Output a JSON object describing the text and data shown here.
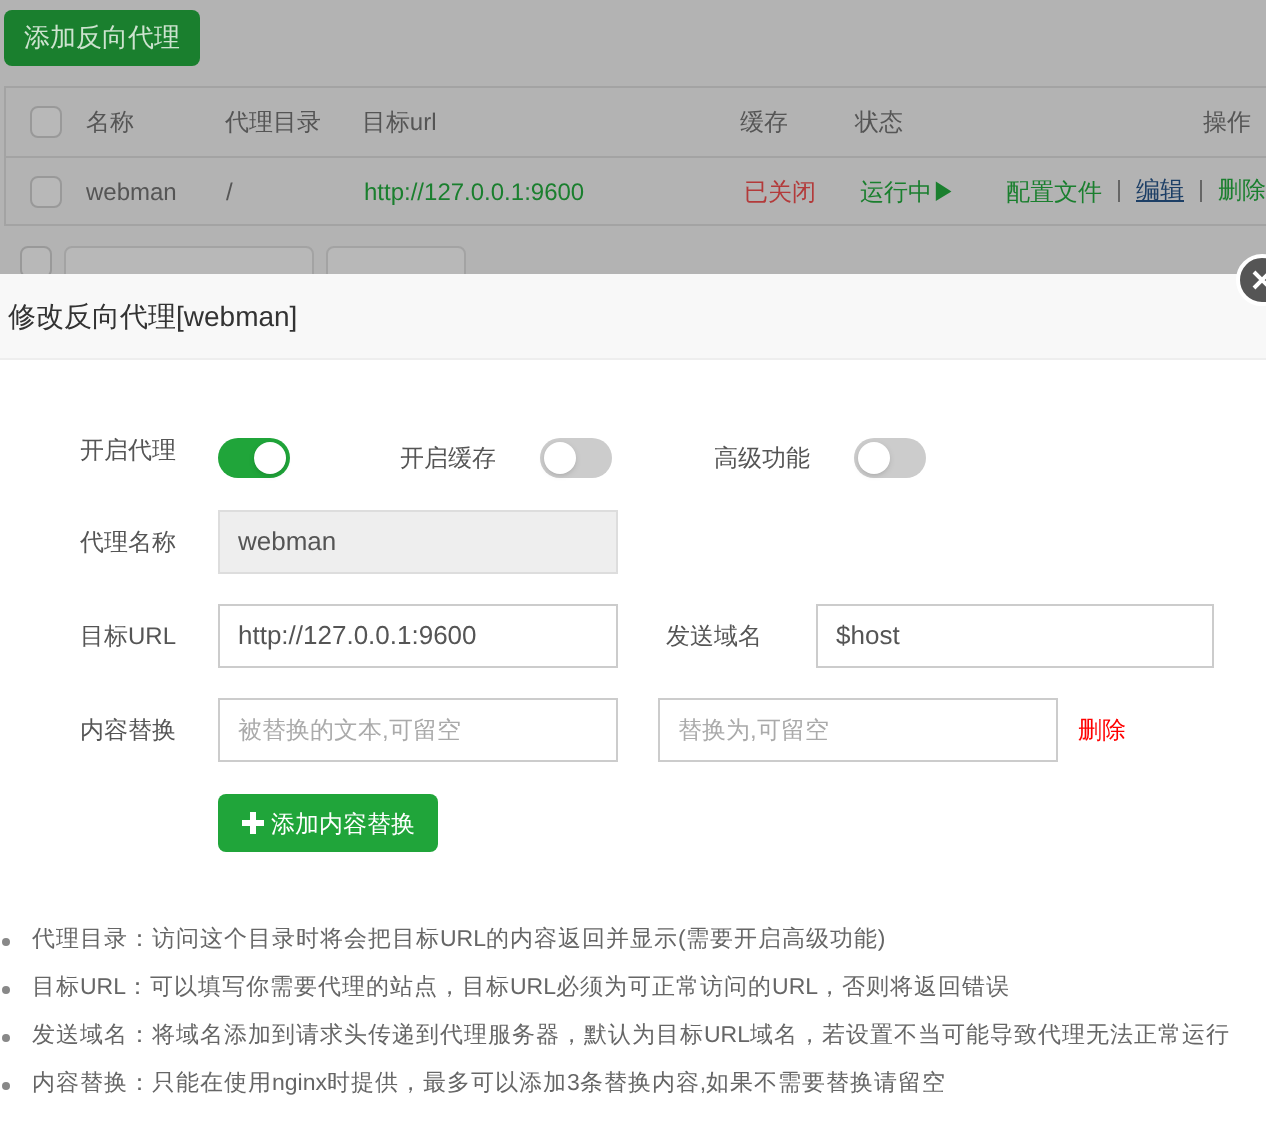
{
  "page": {
    "add_button": "添加反向代理",
    "table": {
      "all_selected": false,
      "columns": [
        "名称",
        "代理目录",
        "目标url",
        "缓存",
        "状态",
        "操作"
      ],
      "rows": [
        {
          "selected": false,
          "name": "webman",
          "dir": "/",
          "url": "http://127.0.0.1:9600",
          "cache": "已关闭",
          "status": "运行中▶",
          "actions": [
            {
              "label": "配置文件",
              "kind": "text"
            },
            {
              "label": "编辑",
              "kind": "link"
            },
            {
              "label": "删除",
              "kind": "text"
            }
          ]
        }
      ]
    },
    "batch_selected": false
  },
  "dialog": {
    "title": "修改反向代理[webman]",
    "toggles": [
      {
        "label": "开启代理",
        "on": true
      },
      {
        "label": "开启缓存",
        "on": false
      },
      {
        "label": "高级功能",
        "on": false
      }
    ],
    "name_label": "代理名称",
    "name_value": "webman",
    "url_label": "目标URL",
    "url_value": "http://127.0.0.1:9600",
    "host_label": "发送域名",
    "host_value": "$host",
    "replace_label": "内容替换",
    "replace_from_placeholder": "被替换的文本,可留空",
    "replace_to_placeholder": "替换为,可留空",
    "delete_label": "删除",
    "add_replace_button": "添加内容替换",
    "notes": [
      "代理目录：访问这个目录时将会把目标URL的内容返回并显示(需要开启高级功能)",
      "目标URL：可以填写你需要代理的站点，目标URL必须为可正常访问的URL，否则将返回错误",
      "发送域名：将域名添加到请求头传递到代理服务器，默认为目标URL域名，若设置不当可能导致代理无法正常运行",
      "内容替换：只能在使用nginx时提供，最多可以添加3条替换内容,如果不需要替换请留空"
    ]
  }
}
